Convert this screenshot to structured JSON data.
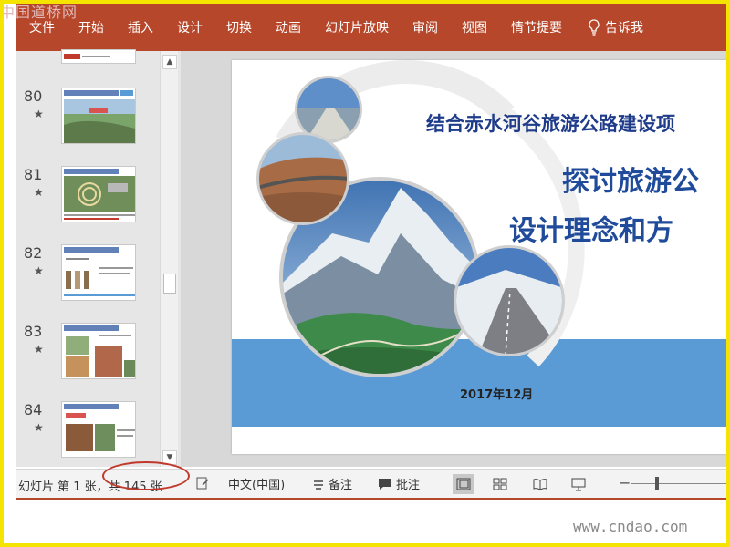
{
  "watermark_top": "中国道桥网",
  "watermark_bottom": "www.cndao.com",
  "ribbon": {
    "tabs": [
      "文件",
      "开始",
      "插入",
      "设计",
      "切换",
      "动画",
      "幻灯片放映",
      "审阅",
      "视图",
      "情节提要"
    ],
    "tell_me": "告诉我",
    "color": "#b7472a"
  },
  "thumbnails": [
    {
      "number": "80",
      "star": "★"
    },
    {
      "number": "81",
      "star": "★"
    },
    {
      "number": "82",
      "star": "★"
    },
    {
      "number": "83",
      "star": "★"
    },
    {
      "number": "84",
      "star": "★"
    }
  ],
  "slide": {
    "title_line1": "结合赤水河谷旅游公路建设项",
    "title_line2": "探讨旅游公",
    "title_line3": "设计理念和方",
    "date": "2017年12月",
    "band_color": "#5b9bd5"
  },
  "statusbar": {
    "slide_info": "幻灯片 第 1 张，共 145 张",
    "language": "中文(中国)",
    "notes": "备注",
    "comments": "批注"
  },
  "icons": {
    "tell_me": "lightbulb-icon",
    "notes": "notes-icon",
    "comments": "comment-icon",
    "normal_view": "normal-view-icon",
    "sorter_view": "slide-sorter-icon",
    "reading_view": "reading-view-icon",
    "slideshow": "slideshow-icon"
  }
}
